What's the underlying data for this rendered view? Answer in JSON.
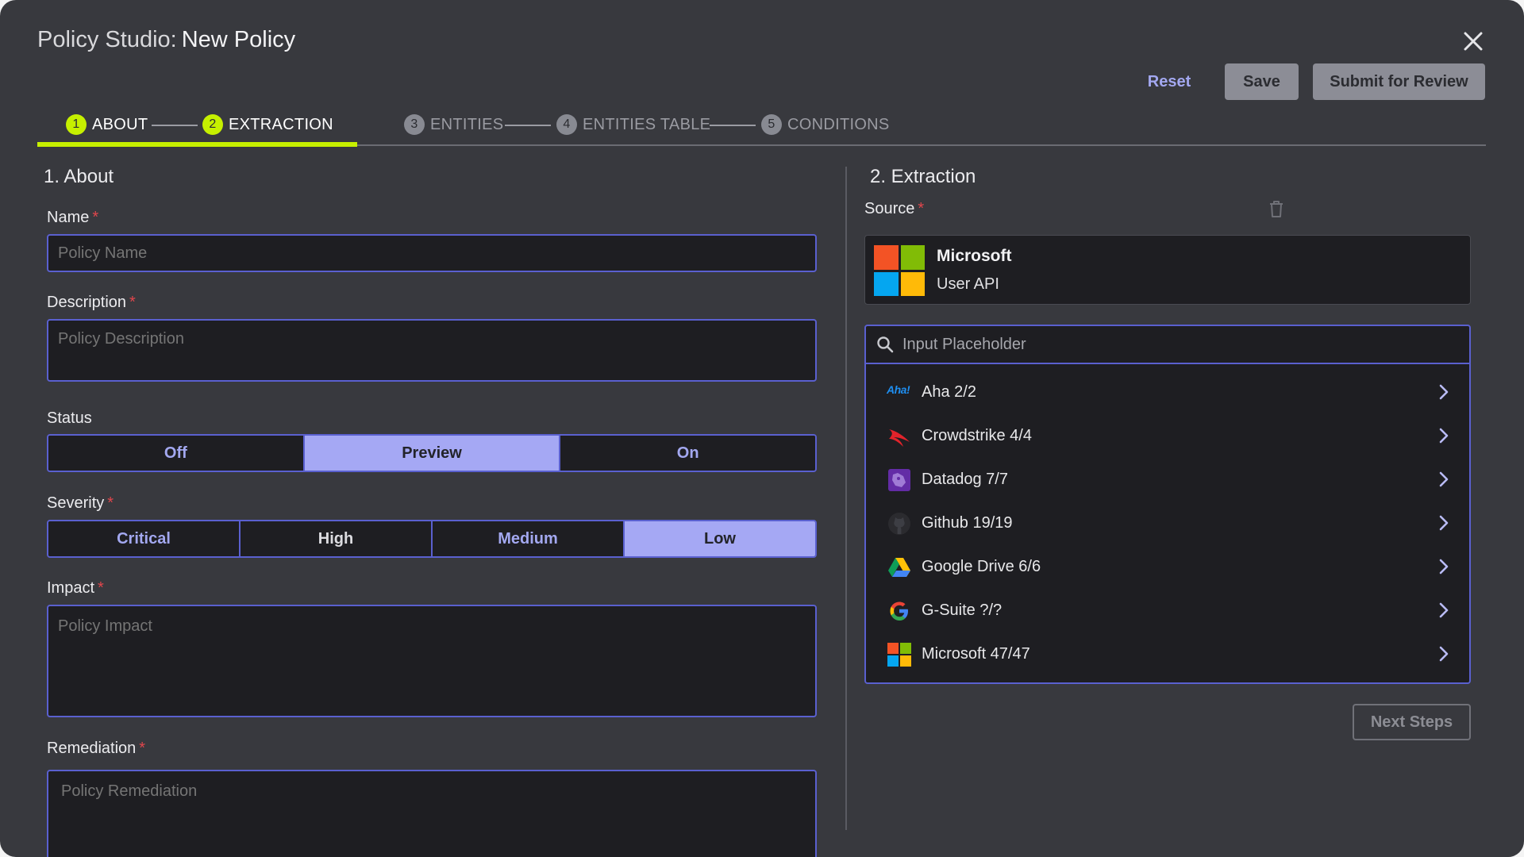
{
  "header": {
    "title_prefix": "Policy Studio:",
    "title_name": "New Policy",
    "reset_label": "Reset",
    "save_label": "Save",
    "submit_label": "Submit for Review"
  },
  "stepper": {
    "steps": [
      {
        "num": "1",
        "label": "ABOUT",
        "state": "done"
      },
      {
        "num": "2",
        "label": "EXTRACTION",
        "state": "done"
      },
      {
        "num": "3",
        "label": "ENTITIES",
        "state": "todo"
      },
      {
        "num": "4",
        "label": "ENTITIES TABLE",
        "state": "todo"
      },
      {
        "num": "5",
        "label": "CONDITIONS",
        "state": "todo"
      }
    ]
  },
  "about": {
    "section_title": "1. About",
    "name_label": "Name",
    "name_placeholder": "Policy Name",
    "description_label": "Description",
    "description_placeholder": "Policy Description",
    "status_label": "Status",
    "status_options": [
      "Off",
      "Preview",
      "On"
    ],
    "status_selected": "Preview",
    "severity_label": "Severity",
    "severity_options": [
      "Critical",
      "High",
      "Medium",
      "Low"
    ],
    "severity_selected": "Low",
    "impact_label": "Impact",
    "impact_placeholder": "Policy Impact",
    "remediation_label": "Remediation",
    "remediation_placeholder": "Policy Remediation",
    "required_mark": "*"
  },
  "extraction": {
    "section_title": "2. Extraction",
    "source_label": "Source",
    "source": {
      "vendor": "Microsoft",
      "api": "User API"
    },
    "search_placeholder": "Input Placeholder",
    "integrations": [
      {
        "label": "Aha 2/2",
        "icon": "aha-icon"
      },
      {
        "label": "Crowdstrike 4/4",
        "icon": "crowdstrike-icon"
      },
      {
        "label": "Datadog 7/7",
        "icon": "datadog-icon"
      },
      {
        "label": "Github 19/19",
        "icon": "github-icon"
      },
      {
        "label": "Google Drive 6/6",
        "icon": "google-drive-icon"
      },
      {
        "label": "G-Suite ?/?",
        "icon": "google-icon"
      },
      {
        "label": "Microsoft 47/47",
        "icon": "microsoft-icon"
      }
    ],
    "aha_logo_text": "Aha!",
    "next_label": "Next Steps"
  },
  "colors": {
    "accent_green": "#c6f000",
    "accent_indigo": "#5a60cf",
    "selected_fill": "#a5a8f4",
    "required_red": "#e0464c"
  }
}
